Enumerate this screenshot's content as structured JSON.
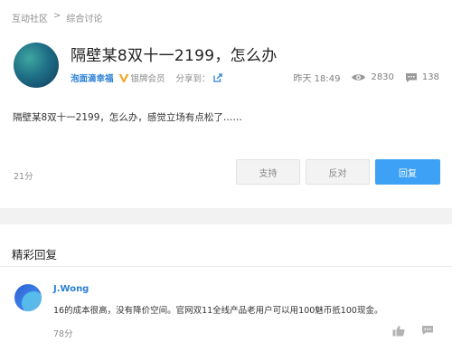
{
  "breadcrumb": {
    "root": "互动社区",
    "separator": ">",
    "current": "综合讨论"
  },
  "post": {
    "title": "隔壁某8双十一2199，怎么办",
    "author": "泡面滴幸福",
    "member_level": "银牌会员",
    "share_label": "分享到：",
    "time": "昨天 18:49",
    "views": "2830",
    "comments": "138",
    "body": "隔壁某8双十一2199，怎么办，感觉立场有点松了……",
    "score": "21分"
  },
  "buttons": {
    "support": "支持",
    "oppose": "反对",
    "reply": "回复"
  },
  "highlights": {
    "title": "精彩回复",
    "replies": [
      {
        "author": "J.Wong",
        "text": "16的成本很高，没有降价空间。官网双11全线产品老用户可以用100魅币抵100现金。",
        "score": "78分"
      }
    ]
  },
  "colors": {
    "accent": "#3da2f5",
    "link": "#2b7fd4",
    "vip": "#f5a623"
  },
  "icons": [
    "vip-badge-icon",
    "share-icon",
    "eye-icon",
    "comment-icon",
    "thumbs-up-icon",
    "reply-icon"
  ]
}
